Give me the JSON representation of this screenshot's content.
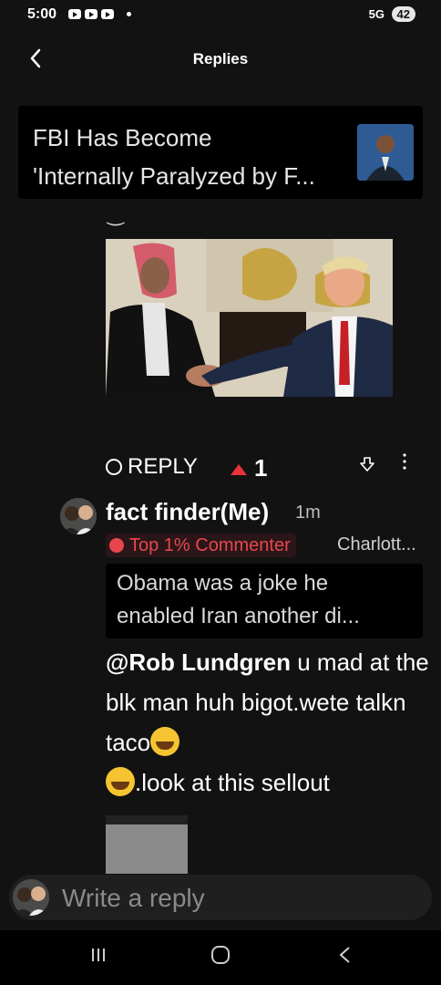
{
  "status": {
    "time": "5:00",
    "network": "5G",
    "battery": "42"
  },
  "header": {
    "title": "Replies"
  },
  "article": {
    "line1": "FBI Has Become",
    "line2": "'Internally Paralyzed by F..."
  },
  "reply_row": {
    "reply_label": "REPLY",
    "upvotes": "1"
  },
  "comment": {
    "author": "fact finder(Me)",
    "time": "1m",
    "badge": "Top 1% Commenter",
    "location": "Charlott...",
    "quote_line1": "Obama was a joke he",
    "quote_line2": "enabled Iran another di...",
    "mention": "@Rob Lundgren",
    "text1": " u mad at the blk man huh bigot.wete talkn taco",
    "text2": ".look at this sellout"
  },
  "input": {
    "placeholder": "Write a reply"
  },
  "colors": {
    "accent": "#e8333a",
    "background": "#121212"
  },
  "icons": [
    "back-icon",
    "reply-icon",
    "upvote-icon",
    "downvote-icon",
    "more-icon",
    "recents-icon",
    "home-icon",
    "nav-back-icon"
  ]
}
